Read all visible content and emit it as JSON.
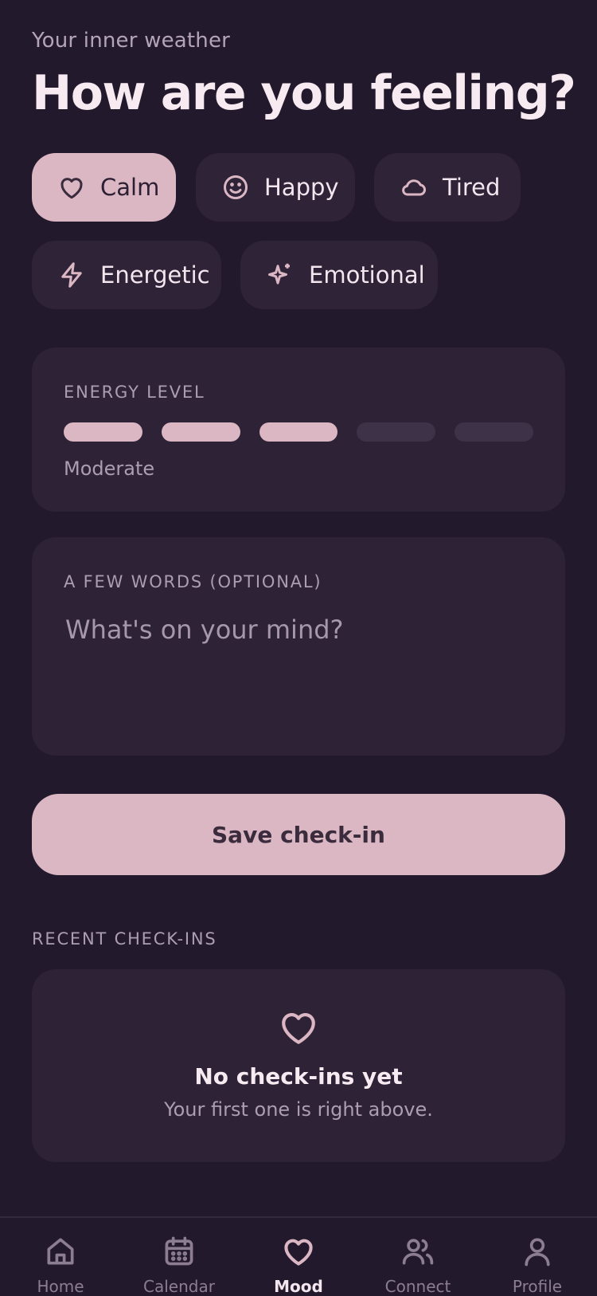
{
  "header": {
    "eyebrow": "Your inner weather",
    "title": "How are you feeling?"
  },
  "moods": [
    {
      "label": "Calm",
      "icon": "heart-icon",
      "selected": true
    },
    {
      "label": "Happy",
      "icon": "smiley-icon",
      "selected": false
    },
    {
      "label": "Tired",
      "icon": "cloud-icon",
      "selected": false
    },
    {
      "label": "Energetic",
      "icon": "lightning-icon",
      "selected": false
    },
    {
      "label": "Emotional",
      "icon": "sparkle-icon",
      "selected": false
    }
  ],
  "energy": {
    "label": "ENERGY LEVEL",
    "level": 3,
    "max": 5,
    "text": "Moderate"
  },
  "note": {
    "label": "A FEW WORDS (OPTIONAL)",
    "placeholder": "What's on your mind?",
    "value": ""
  },
  "save_label": "Save check-in",
  "recent": {
    "label": "RECENT CHECK-INS",
    "empty_icon": "heart-icon",
    "empty_title": "No check-ins yet",
    "empty_subtitle": "Your first one is right above."
  },
  "tabs": [
    {
      "label": "Home",
      "icon": "home-icon",
      "active": false
    },
    {
      "label": "Calendar",
      "icon": "calendar-icon",
      "active": false
    },
    {
      "label": "Mood",
      "icon": "heart-icon",
      "active": true
    },
    {
      "label": "Connect",
      "icon": "people-icon",
      "active": false
    },
    {
      "label": "Profile",
      "icon": "person-icon",
      "active": false
    }
  ],
  "colors": {
    "background": "#221a2c",
    "card": "#2d2236",
    "accent": "#dbb6c3",
    "muted_text": "#ad9db2"
  }
}
